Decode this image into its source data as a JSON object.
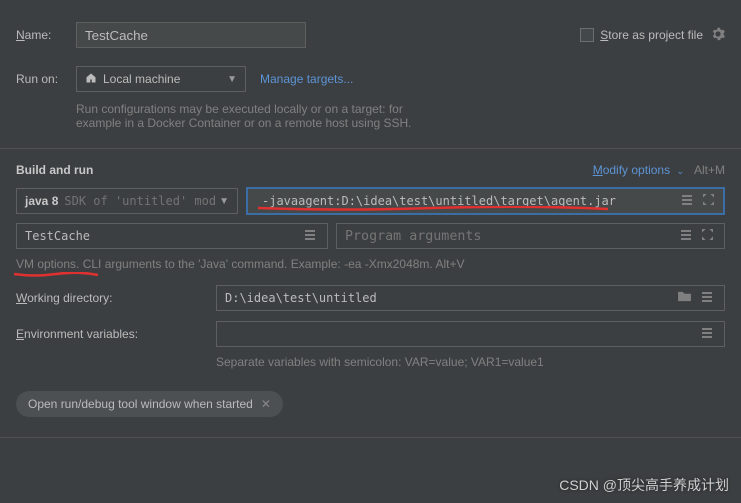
{
  "name": {
    "label_prefix": "N",
    "label_rest": "ame:",
    "value": "TestCache"
  },
  "store": {
    "label_prefix": "S",
    "label_rest": "tore as project file"
  },
  "run_on": {
    "label": "Run on:",
    "value": "Local machine",
    "manage": "Manage targets..."
  },
  "run_hint1": "Run configurations may be executed locally or on a target: for",
  "run_hint2": "example in a Docker Container or on a remote host using SSH.",
  "build_run": "Build and run",
  "modify_prefix": "M",
  "modify_rest": "odify options",
  "alt_m": "Alt+M",
  "jdk": {
    "bold": "java 8",
    "rest": "SDK of 'untitled' mod"
  },
  "vm_options": "-javaagent:D:\\idea\\test\\untitled\\target\\agent.jar",
  "main_class": "TestCache",
  "program_args_placeholder": "Program arguments",
  "vm_hint": "VM options. CLI arguments to the 'Java' command. Example: -ea -Xmx2048m. Alt+V",
  "working_dir": {
    "label_prefix": "W",
    "label_rest": "orking directory:",
    "value": "D:\\idea\\test\\untitled"
  },
  "env": {
    "label_prefix": "E",
    "label_rest": "nvironment variables:"
  },
  "env_hint": "Separate variables with semicolon: VAR=value; VAR1=value1",
  "chip": "Open run/debug tool window when started",
  "watermark": "CSDN @顶尖高手养成计划"
}
